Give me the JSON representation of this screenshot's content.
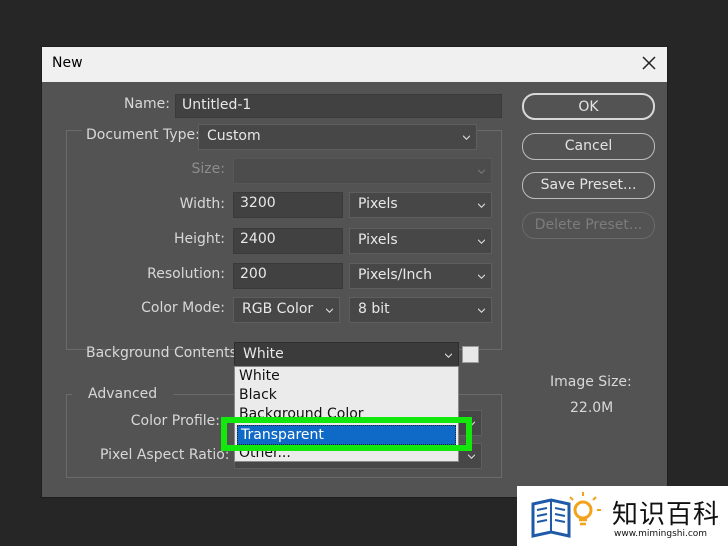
{
  "dialog": {
    "title": "New",
    "name": {
      "label": "Name:",
      "value": "Untitled-1"
    },
    "document_type": {
      "label": "Document Type:",
      "value": "Custom"
    },
    "size": {
      "label": "Size:",
      "value": ""
    },
    "width": {
      "label": "Width:",
      "value": "3200",
      "unit": "Pixels"
    },
    "height": {
      "label": "Height:",
      "value": "2400",
      "unit": "Pixels"
    },
    "resolution": {
      "label": "Resolution:",
      "value": "200",
      "unit": "Pixels/Inch"
    },
    "color_mode": {
      "label": "Color Mode:",
      "value": "RGB Color",
      "depth": "8 bit"
    },
    "background": {
      "label": "Background Contents:",
      "value": "White",
      "options": [
        "White",
        "Black",
        "Background Color",
        "Transparent",
        "Other..."
      ],
      "highlighted_option": "Transparent"
    },
    "advanced": {
      "label": "Advanced",
      "color_profile_label": "Color Profile:",
      "pixel_aspect_label": "Pixel Aspect Ratio:"
    },
    "buttons": {
      "ok": "OK",
      "cancel": "Cancel",
      "save_preset": "Save Preset...",
      "delete_preset": "Delete Preset..."
    },
    "image_size": {
      "label": "Image Size:",
      "value": "22.0M"
    }
  },
  "watermark": {
    "text": "知识百科",
    "url": "www.mimingshi.com"
  },
  "colors": {
    "highlight": "#13e80d",
    "selection": "#0f6ac7",
    "dialog_bg": "#535353"
  }
}
